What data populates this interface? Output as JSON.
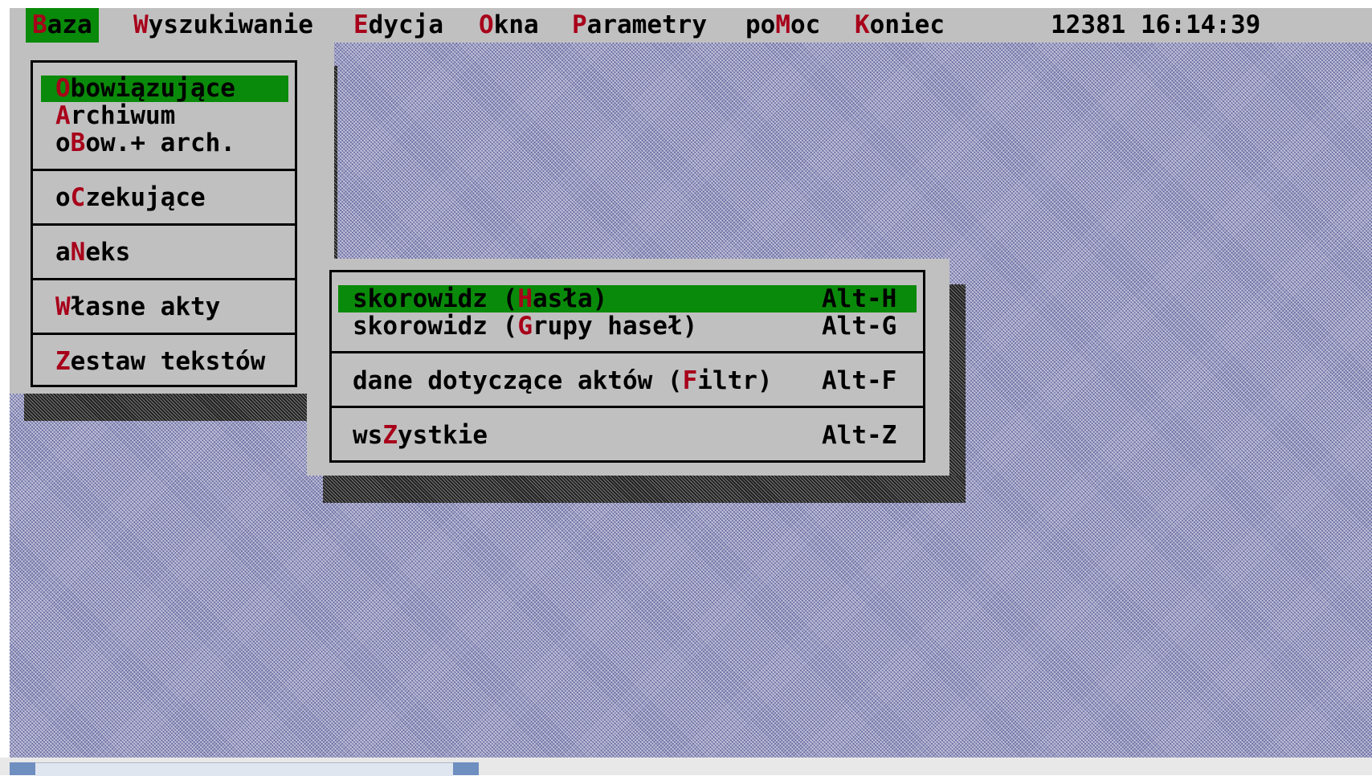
{
  "menubar": {
    "items": [
      {
        "hotkey": "B",
        "rest": "aza"
      },
      {
        "hotkey": "W",
        "rest": "yszukiwanie"
      },
      {
        "hotkey": "E",
        "rest": "dycja"
      },
      {
        "hotkey": "O",
        "rest": "kna"
      },
      {
        "hotkey": "P",
        "rest": "arametry"
      },
      {
        "pre": "po",
        "hotkey": "M",
        "rest": "oc"
      },
      {
        "hotkey": "K",
        "rest": "oniec"
      }
    ],
    "status": "12381 16:14:39"
  },
  "baza_menu": {
    "items": [
      {
        "hotkey": "O",
        "rest": "bowiązujące"
      },
      {
        "hotkey": "A",
        "rest": "rchiwum"
      },
      {
        "pre": "o",
        "hotkey": "B",
        "rest": "ow.+ arch."
      },
      {
        "pre": "o",
        "hotkey": "C",
        "rest": "zekujące"
      },
      {
        "pre": "a",
        "hotkey": "N",
        "rest": "eks"
      },
      {
        "hotkey": "W",
        "rest": "łasne akty"
      },
      {
        "hotkey": "Z",
        "rest": "estaw tekstów"
      }
    ]
  },
  "submenu": {
    "items": [
      {
        "pre": "skorowidz (",
        "hotkey": "H",
        "rest": "asła)",
        "shortcut": "Alt-H"
      },
      {
        "pre": "skorowidz (",
        "hotkey": "G",
        "rest": "rupy haseł)",
        "shortcut": "Alt-G"
      },
      {
        "pre": "dane dotyczące aktów (",
        "hotkey": "F",
        "rest": "iltr)",
        "shortcut": "Alt-F"
      },
      {
        "pre": "ws",
        "hotkey": "Z",
        "rest": "ystkie",
        "shortcut": "Alt-Z"
      }
    ]
  }
}
